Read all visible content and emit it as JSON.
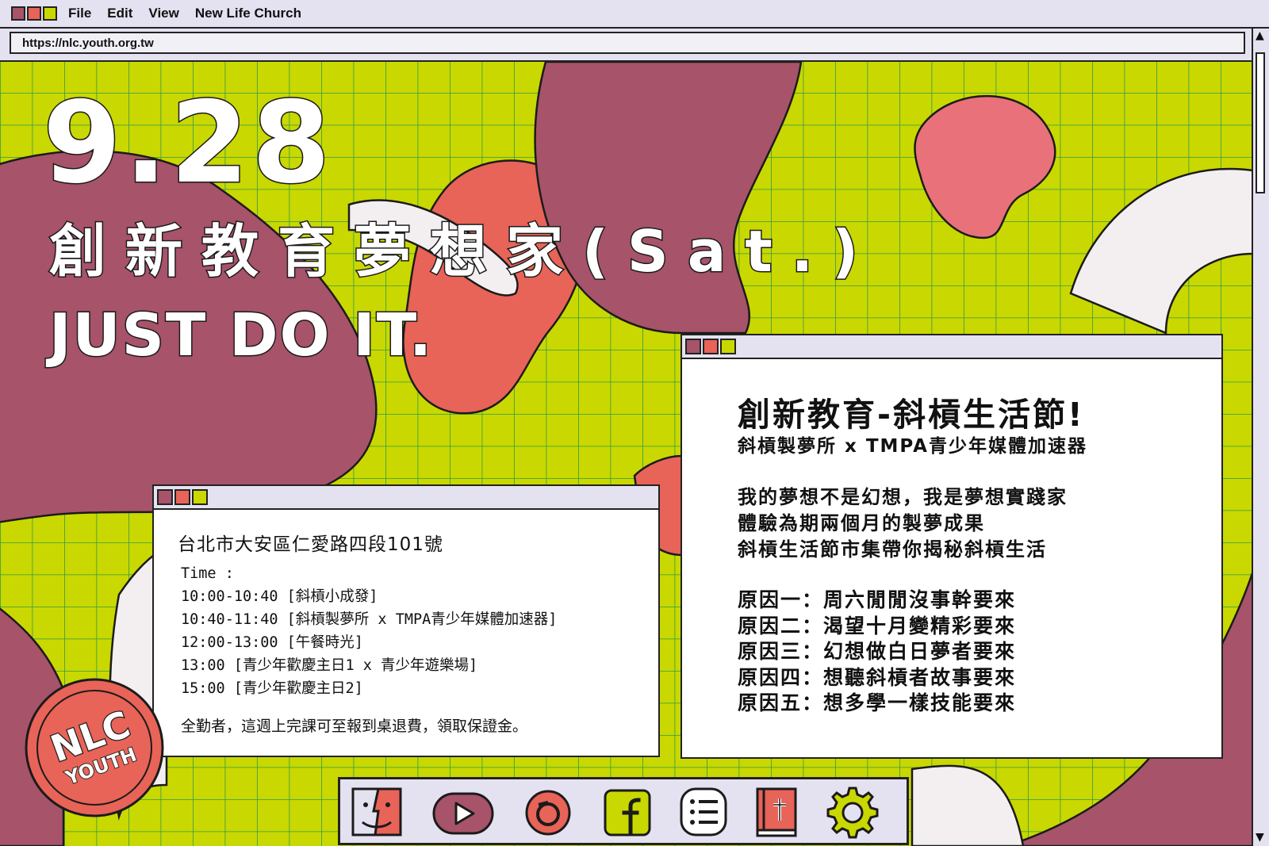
{
  "window": {
    "menu": [
      "File",
      "Edit",
      "View",
      "New Life Church"
    ],
    "url": "https://nlc.youth.org.tw"
  },
  "poster": {
    "date": "9.28",
    "slogan": "創新教育夢想家(Sat.)",
    "tagline": "JUST DO IT."
  },
  "schedule_window": {
    "address": "台北市大安區仁愛路四段101號",
    "time_label": "Time :",
    "items": [
      "10:00-10:40 [斜槓小成發]",
      "10:40-11:40 [斜槓製夢所 x TMPA青少年媒體加速器]",
      "12:00-13:00 [午餐時光]",
      "13:00 [青少年歡慶主日1 x 青少年遊樂場]",
      "15:00 [青少年歡慶主日2]"
    ],
    "note": "全勤者，這週上完課可至報到桌退費，領取保證金。"
  },
  "info_window": {
    "title": "創新教育-斜槓生活節!",
    "subtitle": "斜槓製夢所 x TMPA青少年媒體加速器",
    "lines": [
      "我的夢想不是幻想，我是夢想實踐家",
      "體驗為期兩個月的製夢成果",
      "斜槓生活節市集帶你揭秘斜槓生活"
    ],
    "reasons": [
      "原因一：周六閒閒沒事幹要來",
      "原因二：渴望十月變精彩要來",
      "原因三：幻想做白日夢者要來",
      "原因四：想聽斜槓者故事要來",
      "原因五：想多學一樣技能要來"
    ]
  },
  "logo": {
    "line1": "NLC",
    "line2": "YOUTH"
  },
  "dock": {
    "icons": [
      "finder-icon",
      "youtube-icon",
      "instagram-icon",
      "facebook-icon",
      "list-icon",
      "bible-icon",
      "settings-icon"
    ]
  },
  "colors": {
    "lime": "#c9d800",
    "maroon": "#a7536a",
    "coral": "#e86358",
    "pink": "#e8717a",
    "panel": "#e4e2f0",
    "grid": "#2f9a4d"
  }
}
